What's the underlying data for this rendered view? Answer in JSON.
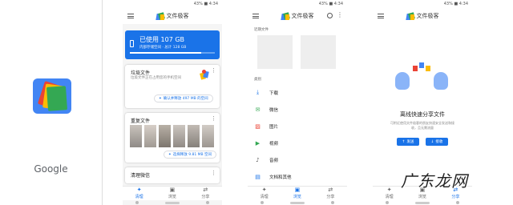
{
  "splash": {
    "brand": "Google"
  },
  "app": {
    "title": "文件极客"
  },
  "status": {
    "battery": "43% ■ 4:34"
  },
  "clean_screen": {
    "storage": {
      "used": "已使用 107 GB",
      "detail": "内部存储空间 · 总计 128 GB",
      "used_fraction": 0.84
    },
    "junk": {
      "title": "垃圾文件",
      "subtitle": "垃圾文件正在占用您的手机空间",
      "button": "确认并释放 497 MB 的空间"
    },
    "duplicates": {
      "title": "重复文件",
      "button": "选择释放 9.81 MB 空间"
    },
    "wechat": {
      "title": "清理微信"
    }
  },
  "browse_screen": {
    "recent_label": "近期文件",
    "category_label": "类别",
    "categories": [
      {
        "label": "下载",
        "icon": "download-icon",
        "color": "#1a73e8"
      },
      {
        "label": "微信",
        "icon": "wechat-icon",
        "color": "#34a853"
      },
      {
        "label": "图片",
        "icon": "image-icon",
        "color": "#ea4335"
      },
      {
        "label": "视频",
        "icon": "video-icon",
        "color": "#34a853"
      },
      {
        "label": "音频",
        "icon": "audio-icon",
        "color": "#555555"
      },
      {
        "label": "文档和其他",
        "icon": "document-icon",
        "color": "#1a73e8"
      }
    ]
  },
  "share_screen": {
    "title": "离线快速分享文件",
    "description": "可附近使用文件极客的朋友快速安全发送和接收，且无需流量",
    "send": "发送",
    "receive": "接收"
  },
  "nav": {
    "clean": "清理",
    "browse": "浏览",
    "share": "分享"
  },
  "watermark": "广东龙网",
  "colors": {
    "accent": "#1a73e8",
    "storage_bg": "#1a73e8"
  }
}
